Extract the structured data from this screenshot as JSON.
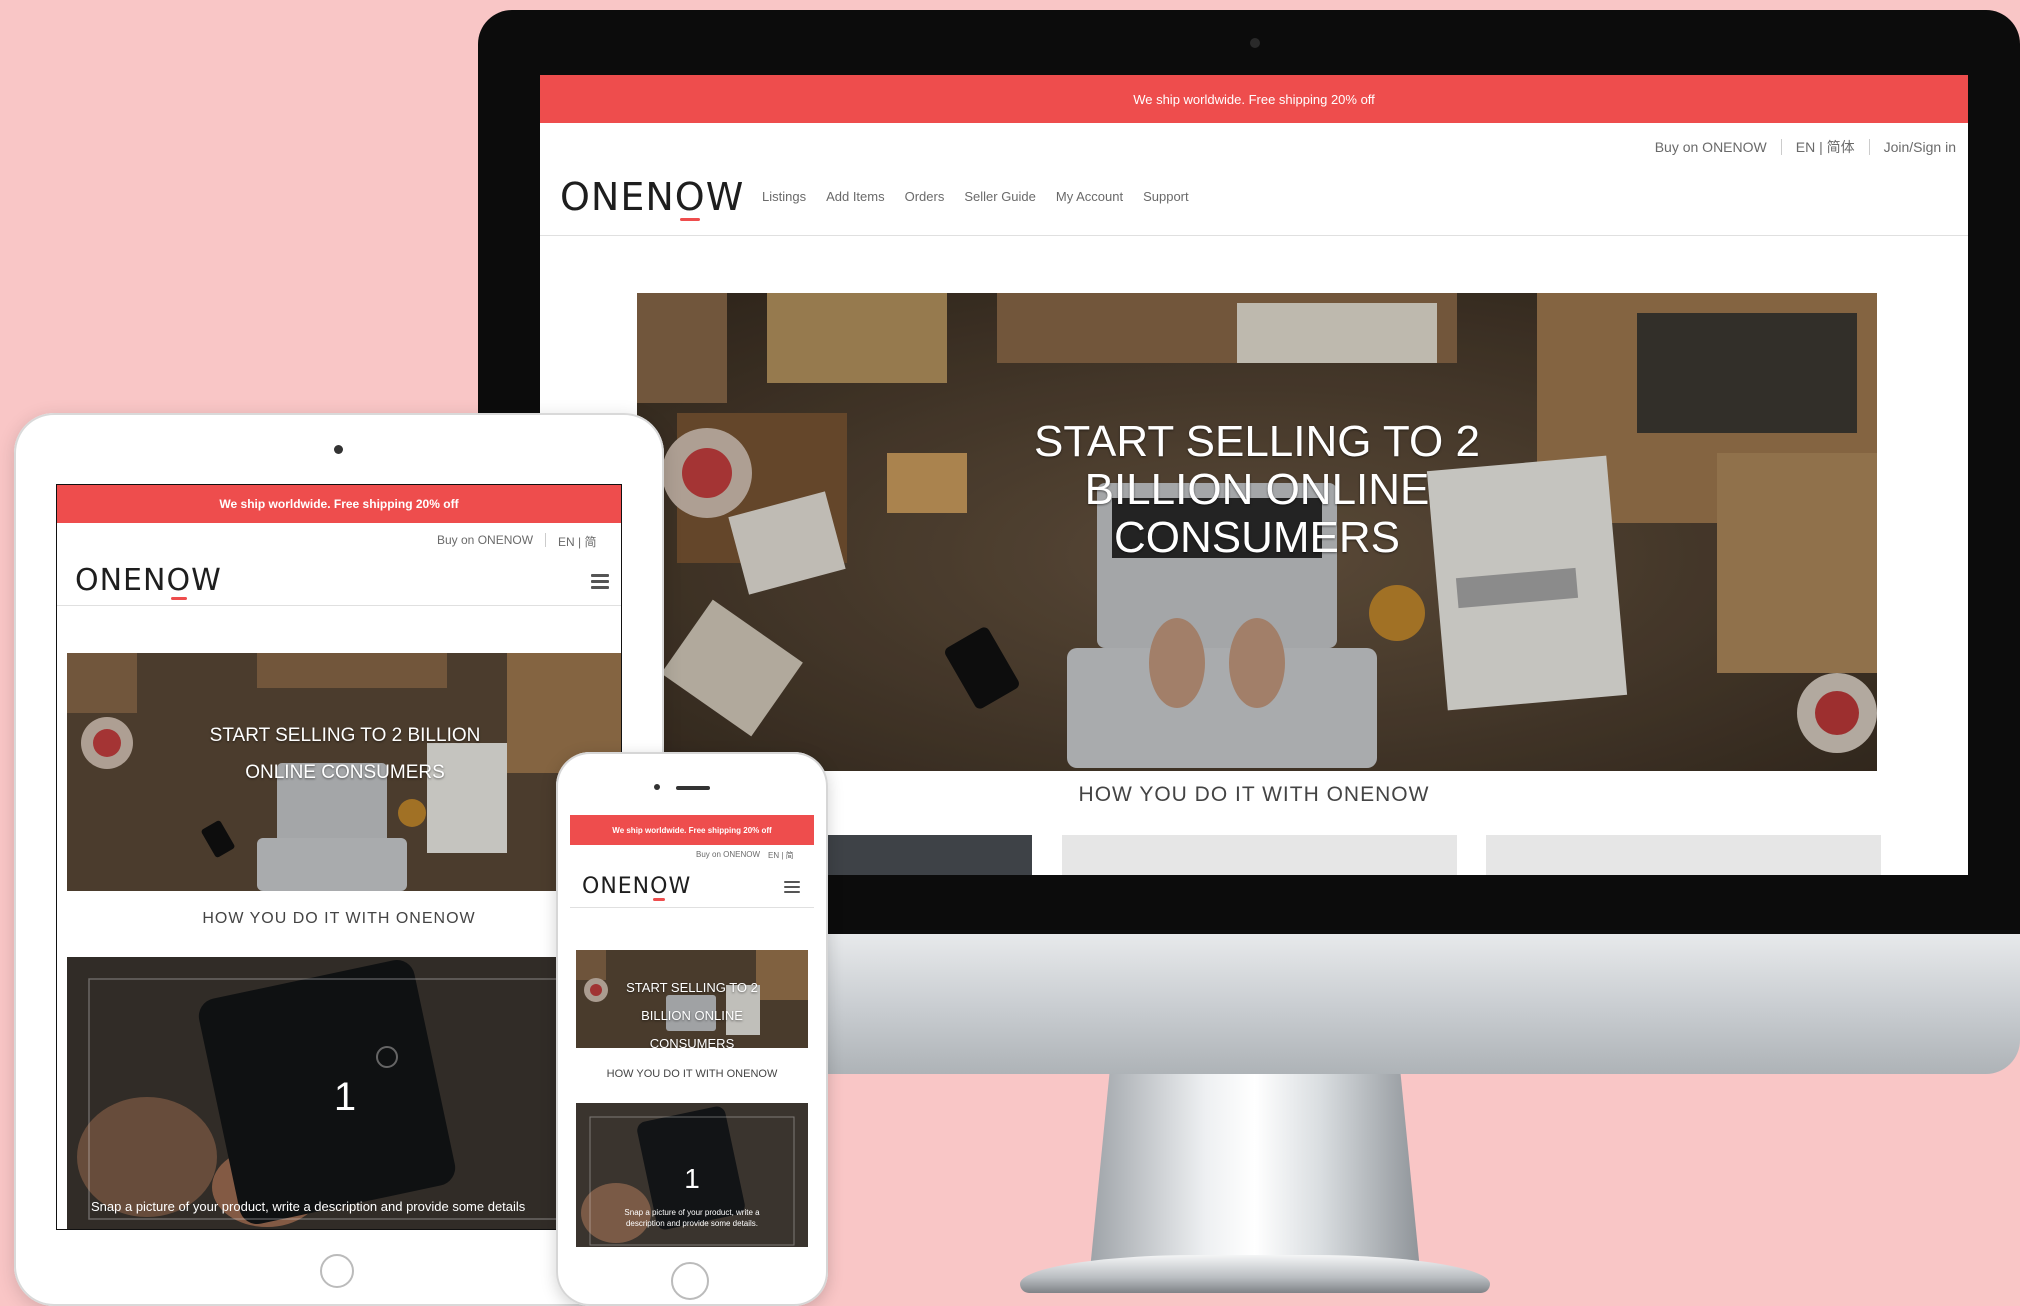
{
  "colors": {
    "background": "#f9c6c6",
    "brand_red": "#ee4d4d",
    "bezel": "#0c0c0c"
  },
  "desktop": {
    "banner": "We ship worldwide. Free shipping 20% off",
    "topbar": {
      "buy_on": "Buy on ONENOW",
      "lang": "EN | 简体",
      "join": "Join/Sign in"
    },
    "logo": {
      "left": "ONEN",
      "mid": "O",
      "right": "W"
    },
    "nav": [
      "Listings",
      "Add Items",
      "Orders",
      "Seller Guide",
      "My Account",
      "Support"
    ],
    "hero": {
      "line1": "START SELLING TO 2",
      "line2": "BILLION ONLINE",
      "line3": "CONSUMERS"
    },
    "how_title": "HOW YOU DO IT WITH ONENOW"
  },
  "tablet": {
    "banner": "We ship worldwide. Free shipping 20% off",
    "topbar": {
      "buy_on": "Buy on ONENOW",
      "lang": "EN | 简"
    },
    "logo": {
      "left": "ONEN",
      "mid": "O",
      "right": "W"
    },
    "menu_icon": "hamburger-menu-icon",
    "hero": {
      "line1": "START SELLING TO 2 BILLION",
      "line2": "ONLINE CONSUMERS"
    },
    "how_title": "HOW YOU DO IT WITH ONENOW",
    "step_number": "1",
    "step_text": "Snap a picture of your product, write a description and provide some details"
  },
  "phone": {
    "banner": "We ship worldwide. Free shipping 20% off",
    "topbar": {
      "buy_on": "Buy on ONENOW",
      "lang": "EN | 简"
    },
    "logo": {
      "left": "ONEN",
      "mid": "O",
      "right": "W"
    },
    "menu_icon": "hamburger-menu-icon",
    "hero": {
      "line1": "START SELLING TO 2",
      "line2": "BILLION ONLINE",
      "line3": "CONSUMERS"
    },
    "how_title": "HOW YOU DO IT WITH ONENOW",
    "step_number": "1",
    "step_text": "Snap a picture of your product, write a description and provide some details."
  }
}
